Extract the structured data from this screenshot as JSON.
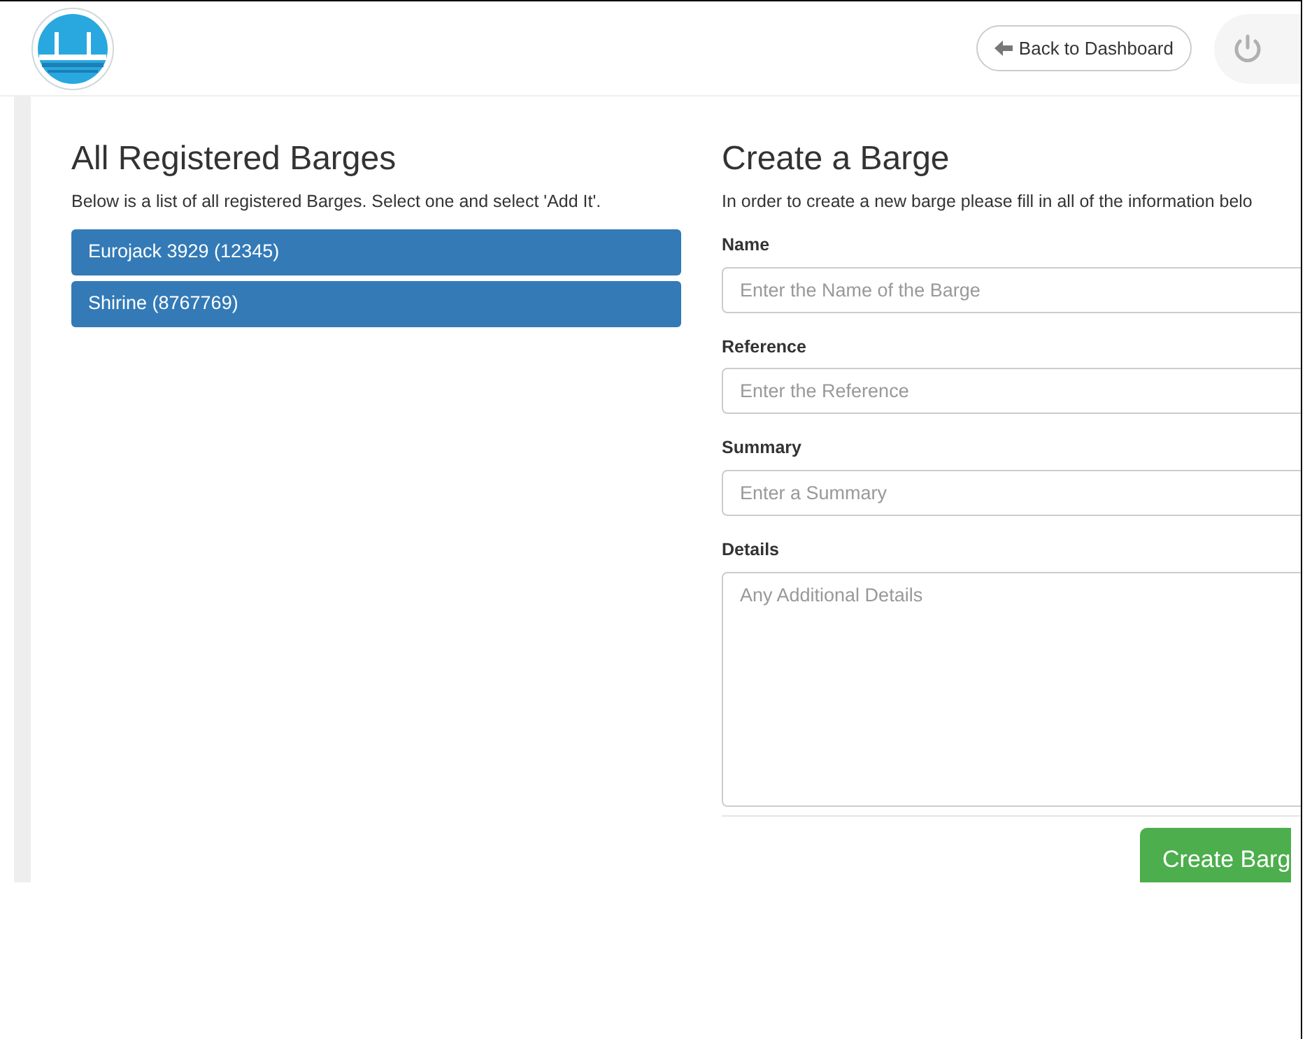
{
  "header": {
    "back_button": "Back to Dashboard"
  },
  "barges": {
    "title": "All Registered Barges",
    "intro": "Below is a list of all registered Barges. Select one and select 'Add It'.",
    "items": [
      {
        "label": "Eurojack 3929 (12345)"
      },
      {
        "label": "Shirine (8767769)"
      }
    ]
  },
  "form": {
    "title": "Create a Barge",
    "intro": "In order to create a new barge please fill in all of the information belo",
    "fields": [
      {
        "kind": "input",
        "label": "Name",
        "placeholder": "Enter the Name of the Barge"
      },
      {
        "kind": "input",
        "label": "Reference",
        "placeholder": "Enter the Reference"
      },
      {
        "kind": "input",
        "label": "Summary",
        "placeholder": "Enter a Summary"
      },
      {
        "kind": "textarea",
        "label": "Details",
        "placeholder": "Any Additional Details"
      }
    ],
    "submit": "Create Barg"
  }
}
